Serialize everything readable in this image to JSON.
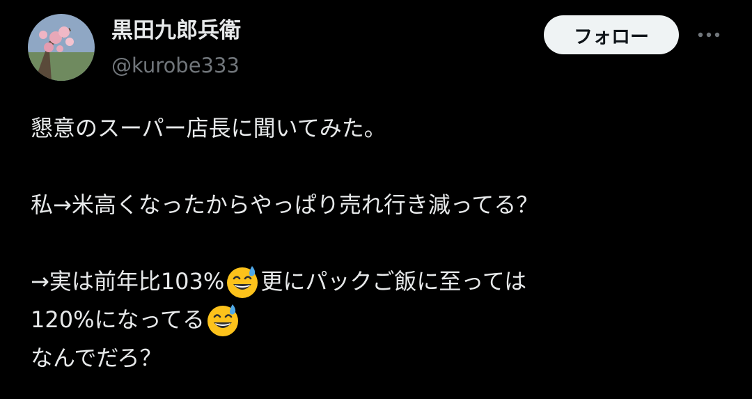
{
  "post": {
    "author": {
      "display_name": "黒田九郎兵衛",
      "handle": "@kurobe333",
      "avatar_icon": "avatar-blossom-photo"
    },
    "follow_label": "フォロー",
    "more_icon": "more-horizontal-icon",
    "text_lines": {
      "line1": "懇意のスーパー店長に聞いてみた。",
      "line2": "私→米高くなったからやっぱり売れ行き減ってる？",
      "line3a": "→実は前年比103%",
      "line3b": "更にパックご飯に至っては",
      "line4a": "120%になってる",
      "line5": "なんでだろ？"
    },
    "emoji_name": "grinning-face-with-sweat-emoji"
  },
  "colors": {
    "background": "#000000",
    "primary_text": "#e7e9ea",
    "secondary_text": "#71767b",
    "button_bg": "#eff3f4",
    "button_text": "#0f1419"
  }
}
